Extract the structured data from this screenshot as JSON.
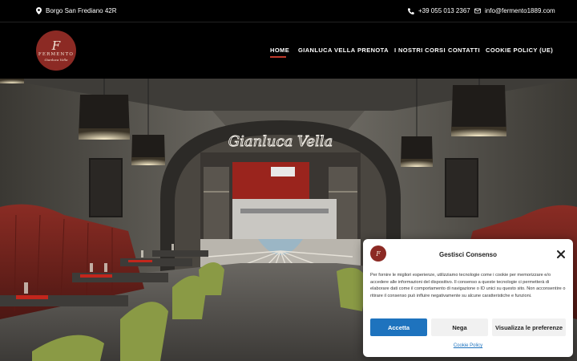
{
  "topbar": {
    "address": "Borgo San Frediano 42R",
    "phone": "+39 055 013 2367",
    "email": "info@fermento1889.com",
    "icons": {
      "address": "map-pin-icon",
      "phone": "phone-icon",
      "email": "envelope-icon"
    }
  },
  "logo": {
    "monogram": "F",
    "brand": "FERMENTO",
    "signature": "Gianluca Vella"
  },
  "nav": {
    "items": [
      {
        "label": "HOME",
        "active": true
      },
      {
        "label": "GIANLUCA VELLA",
        "active": false
      },
      {
        "label": "PRENOTA",
        "active": false
      },
      {
        "label": "I NOSTRI CORSI",
        "active": false
      },
      {
        "label": "CONTATTI",
        "active": false
      },
      {
        "label": "COOKIE POLICY (UE)",
        "active": false
      }
    ],
    "accent_color": "#c0392b"
  },
  "hero": {
    "neon_sign": "Gianluca Vella"
  },
  "consent": {
    "title": "Gestisci Consenso",
    "text": "Per fornire le migliori esperienze, utilizziamo tecnologie come i cookie per memorizzare e/o accedere alle informazioni del dispositivo. Il consenso a queste tecnologie ci permetterà di elaborare dati come il comportamento di navigazione o ID unici su questo sito. Non acconsentire o ritirare il consenso può influire negativamente su alcune caratteristiche e funzioni.",
    "accept_label": "Accetta",
    "deny_label": "Nega",
    "prefs_label": "Visualizza le preferenze",
    "link_label": "Cookie Policy",
    "accent_color": "#1e73be",
    "close_icon": "close-icon"
  }
}
